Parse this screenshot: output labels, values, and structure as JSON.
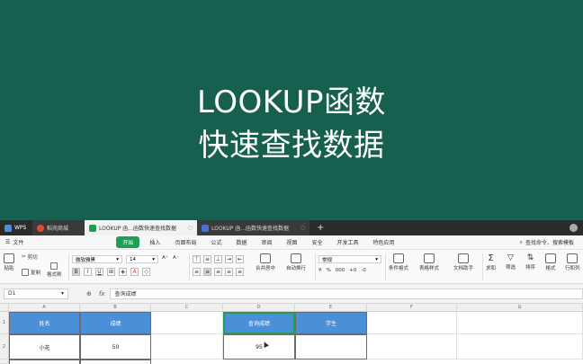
{
  "overlay": {
    "line1": "LOOKUP函数",
    "line2": "快速查找数据"
  },
  "tabs": {
    "wps": "WPS",
    "store": "稻壳商城",
    "active_doc": "LOOKUP 函...函数快速查找数据",
    "doc2": "LOOKUP 函...函数快速查找数据",
    "plus": "+"
  },
  "menu": {
    "file": "文件",
    "items": [
      "开始",
      "插入",
      "页面布局",
      "公式",
      "数据",
      "审阅",
      "视图",
      "安全",
      "开发工具",
      "特色应用"
    ],
    "active": "开始",
    "search": "查找命令、搜索模板"
  },
  "ribbon": {
    "cut": "剪切",
    "paste": "粘贴",
    "copy": "复制",
    "format_painter": "格式刷",
    "font_name": "微软雅黑",
    "font_size": "14",
    "merge": "合并居中",
    "wrap": "自动换行",
    "number_format": "常规",
    "conditional": "条件格式",
    "table_style": "表格样式",
    "doc_helper": "文档助手",
    "sum": "求和",
    "filter": "筛选",
    "sort": "排序",
    "format": "格式",
    "rowcol": "行和列"
  },
  "formula": {
    "cell_ref": "D1",
    "content": "查询成绩"
  },
  "grid": {
    "columns": [
      "A",
      "B",
      "C",
      "D",
      "E",
      "F",
      "G"
    ],
    "rows": [
      "1",
      "2"
    ],
    "cells": {
      "A1": "姓名",
      "B1": "成绩",
      "D1": "查询成绩",
      "E1": "学生",
      "A2": "小花",
      "B2": "50",
      "D2": "95"
    },
    "header_color": "#4a8fd8",
    "selection_color": "#1e9d55"
  },
  "colors": {
    "background": "#17604f",
    "accent": "#1e9d55"
  }
}
